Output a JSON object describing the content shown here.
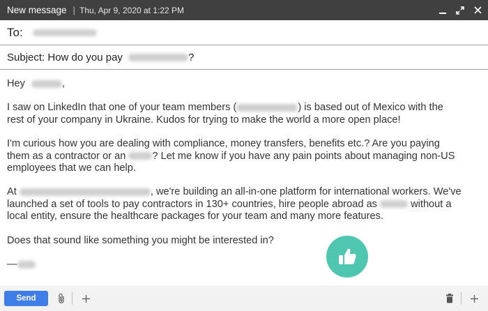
{
  "window": {
    "title": "New message",
    "timestamp": "Thu, Apr 9, 2020 at 1:22 PM",
    "icons": [
      "minimize-icon",
      "expand-icon",
      "close-icon"
    ]
  },
  "to": {
    "label": "To:"
  },
  "subject": {
    "prefix": "Subject: How do you pay",
    "suffix": "?"
  },
  "message": {
    "greeting_prefix": "Hey",
    "greeting_suffix": ",",
    "p1a": "I saw on LinkedIn that one of your team members (",
    "p1b": ") is based out of Mexico with the",
    "p1c": "rest of your company in Ukraine. Kudos for trying to make the world a more open place!",
    "p2a": "I'm curious how you are dealing with compliance, money transfers, benefits etc.? Are you paying",
    "p2b": "them as a contractor or an",
    "p2c": "? Let me know if you have any pain points about managing non-US",
    "p2d": "employees that we can help.",
    "p3a": "At",
    "p3b": ", we're building an all-in-one platform for international workers. We've",
    "p3c": "launched a set of tools to pay contractors in 130+ countries, hire people abroad as",
    "p3d": "without a",
    "p3e": "local entity, ensure the healthcare packages for your team and many more features.",
    "p4": "Does that sound like something you might be interested in?",
    "signoff": "—"
  },
  "toolbar": {
    "send_label": "Send",
    "icons": [
      "attach-icon",
      "add-icon",
      "trash-icon",
      "add-icon"
    ]
  },
  "colors": {
    "titlebar": "#404040",
    "send": "#3f7ee8",
    "thumb": "#4fc7b0",
    "bottombar": "#f2f2f2"
  }
}
